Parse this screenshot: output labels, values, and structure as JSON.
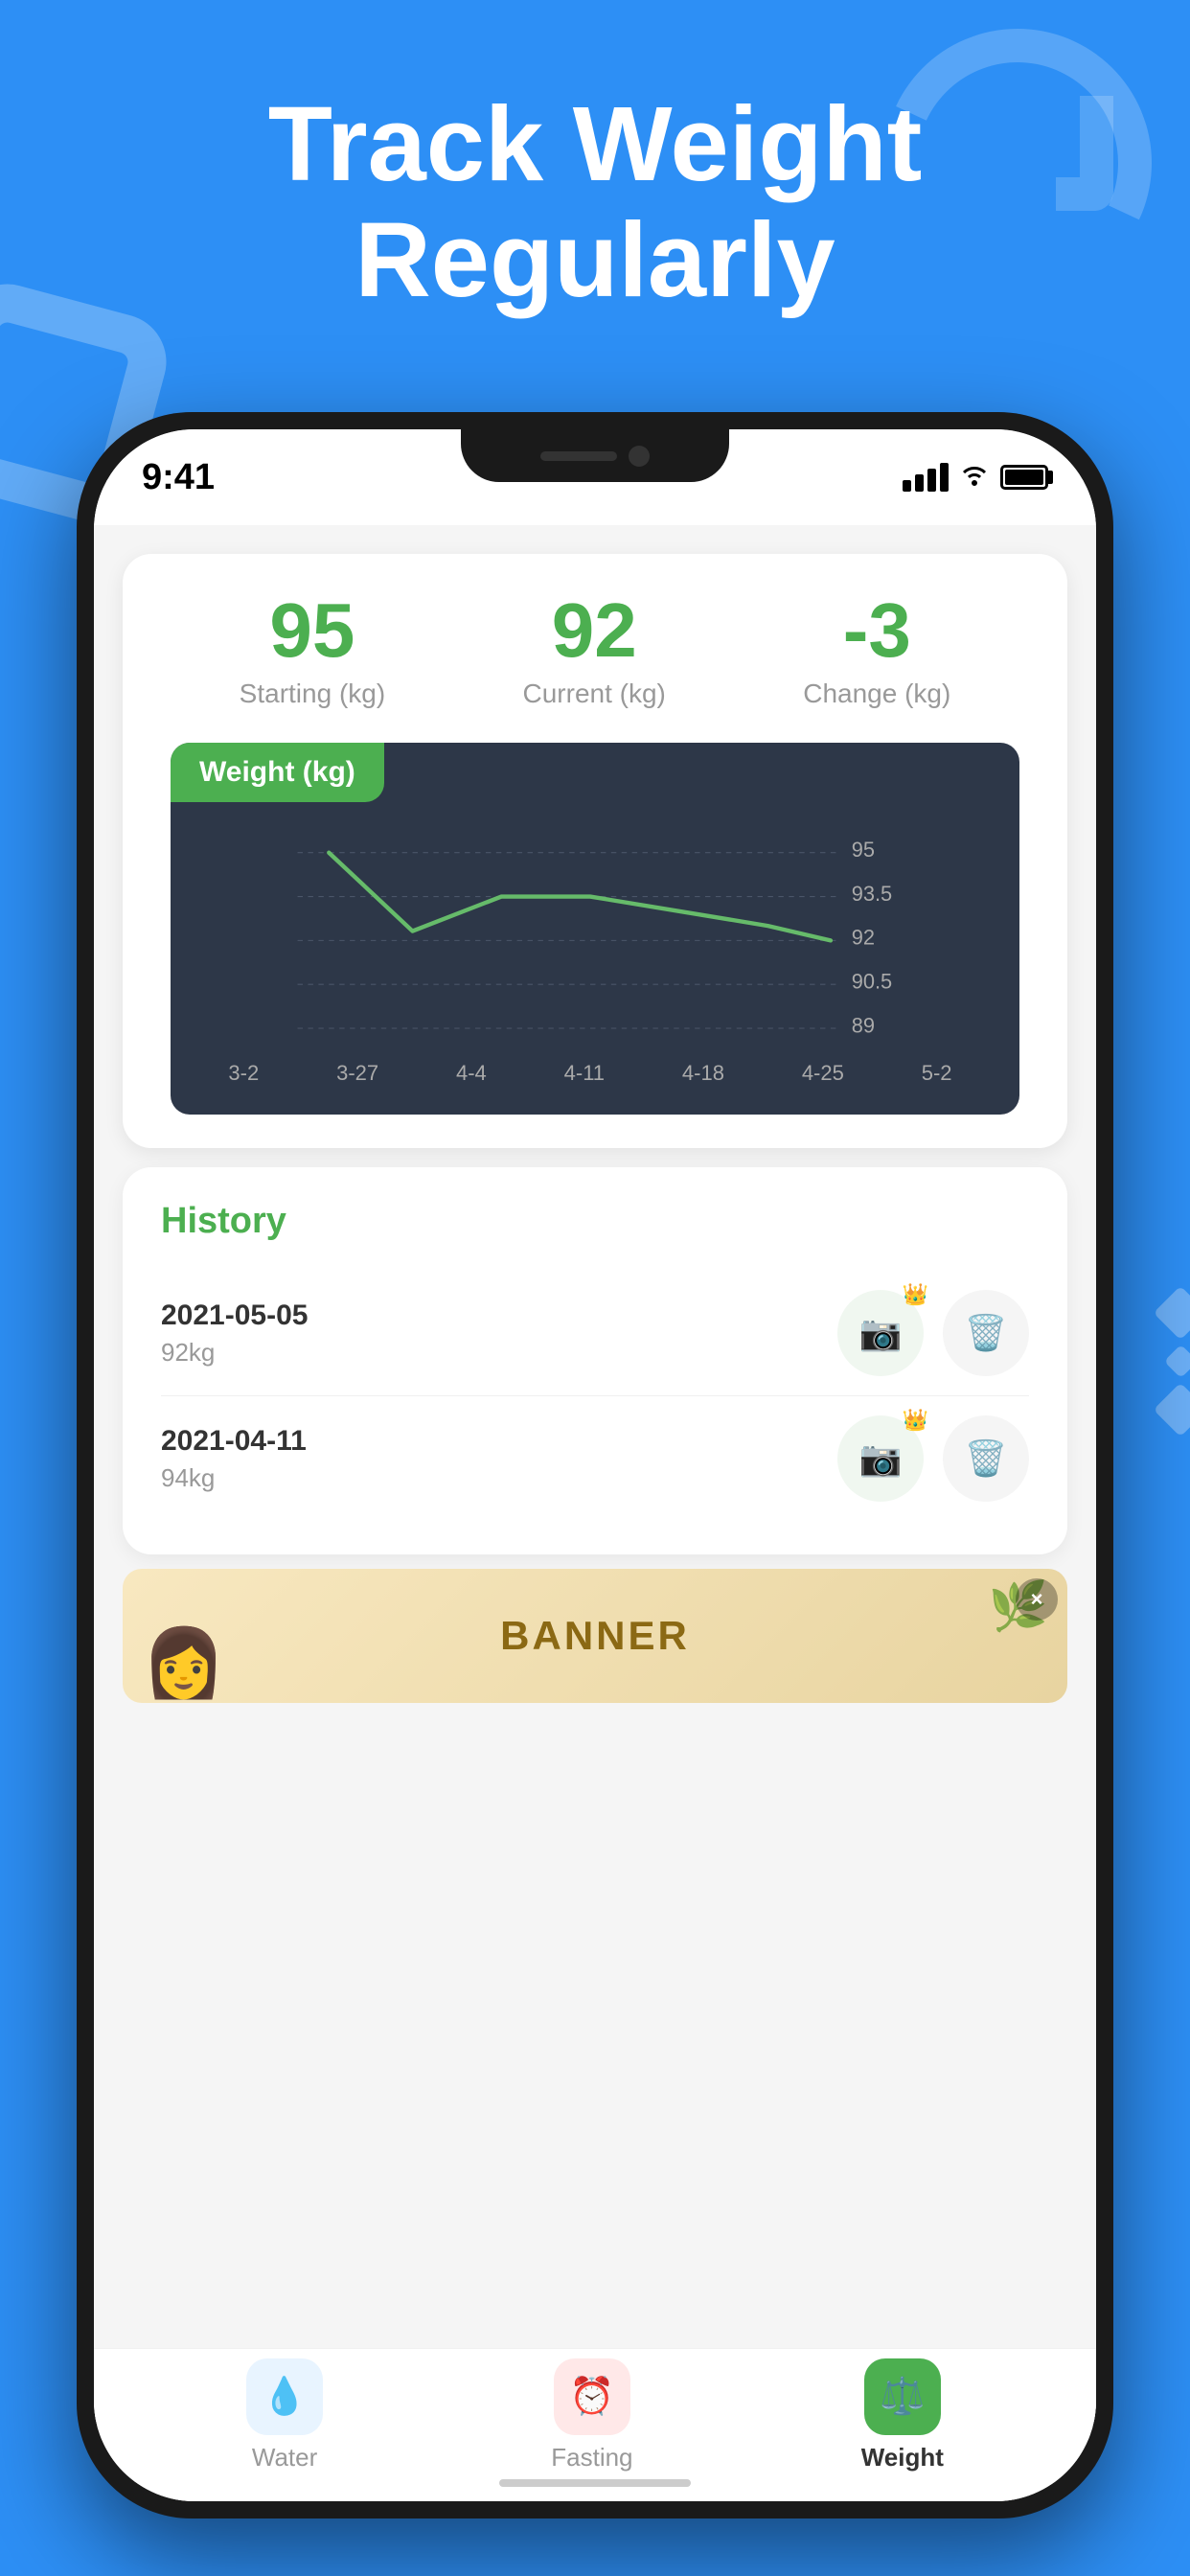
{
  "header": {
    "line1": "Track Weight",
    "line2": "Regularly"
  },
  "status_bar": {
    "time": "9:41"
  },
  "stats": {
    "starting_value": "95",
    "starting_label": "Starting (kg)",
    "current_value": "92",
    "current_label": "Current (kg)",
    "change_value": "-3",
    "change_label": "Change (kg)"
  },
  "chart": {
    "title": "Weight",
    "unit": "(kg)",
    "y_labels": [
      "95",
      "93.5",
      "92",
      "90.5",
      "89"
    ],
    "x_labels": [
      "3-2",
      "3-27",
      "4-4",
      "4-11",
      "4-18",
      "4-25",
      "5-2"
    ]
  },
  "history": {
    "title": "History",
    "items": [
      {
        "date": "2021-05-05",
        "weight": "92kg"
      },
      {
        "date": "2021-04-11",
        "weight": "94kg"
      }
    ]
  },
  "banner": {
    "text": "BANNER",
    "close_label": "×"
  },
  "nav": {
    "items": [
      {
        "key": "water",
        "label": "Water",
        "active": false
      },
      {
        "key": "fasting",
        "label": "Fasting",
        "active": false
      },
      {
        "key": "weight",
        "label": "Weight",
        "active": true
      }
    ]
  }
}
